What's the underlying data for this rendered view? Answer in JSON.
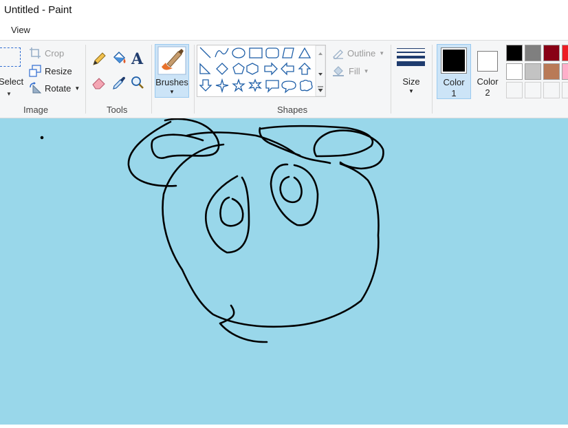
{
  "window": {
    "title": "Untitled - Paint"
  },
  "menu": {
    "view_label": "View"
  },
  "ribbon": {
    "image_group": {
      "label": "Image",
      "select_label": "Select",
      "crop_label": "Crop",
      "resize_label": "Resize",
      "rotate_label": "Rotate"
    },
    "tools_group": {
      "label": "Tools"
    },
    "brushes_label": "Brushes",
    "shapes_group": {
      "label": "Shapes",
      "outline_label": "Outline",
      "fill_label": "Fill"
    },
    "size_label": "Size",
    "color1": {
      "label_line1": "Color",
      "label_line2": "1",
      "value": "#000000"
    },
    "color2": {
      "label_line1": "Color",
      "label_line2": "2",
      "value": "#ffffff"
    },
    "palette": [
      "#000000",
      "#7f7f7f",
      "#880015",
      "#ed1c24",
      "#ffffff",
      "#c3c3c3",
      "#b97a57",
      "#ffaec9",
      "#f5f6f7",
      "#f5f6f7",
      "#f5f6f7",
      "#f5f6f7"
    ]
  },
  "canvas": {
    "background": "#99d7ea",
    "stroke": "#000000"
  }
}
